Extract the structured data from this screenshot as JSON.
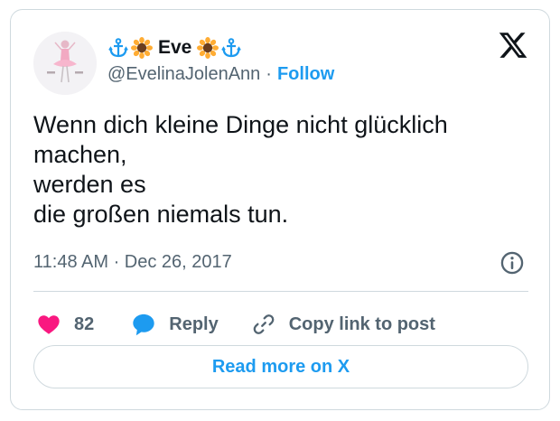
{
  "author": {
    "name": "Eve",
    "name_prefix_icons": [
      "anchor-icon",
      "sunflower-icon"
    ],
    "name_suffix_icons": [
      "sunflower-icon",
      "anchor-icon"
    ],
    "handle": "@EvelinaJolenAnn",
    "separator": "·",
    "follow_label": "Follow"
  },
  "tweet": {
    "lines": [
      "Wenn dich kleine Dinge nicht glücklich",
      "machen,",
      "werden es",
      "die großen niemals tun."
    ],
    "timestamp": "11:48 AM · Dec 26, 2017"
  },
  "actions": {
    "like_count": "82",
    "reply_label": "Reply",
    "copy_label": "Copy link to post"
  },
  "read_more_label": "Read more on X",
  "colors": {
    "accent": "#1d9bf0",
    "like": "#f91880",
    "muted": "#536471",
    "text": "#0f1419",
    "border": "#cfd9de"
  }
}
